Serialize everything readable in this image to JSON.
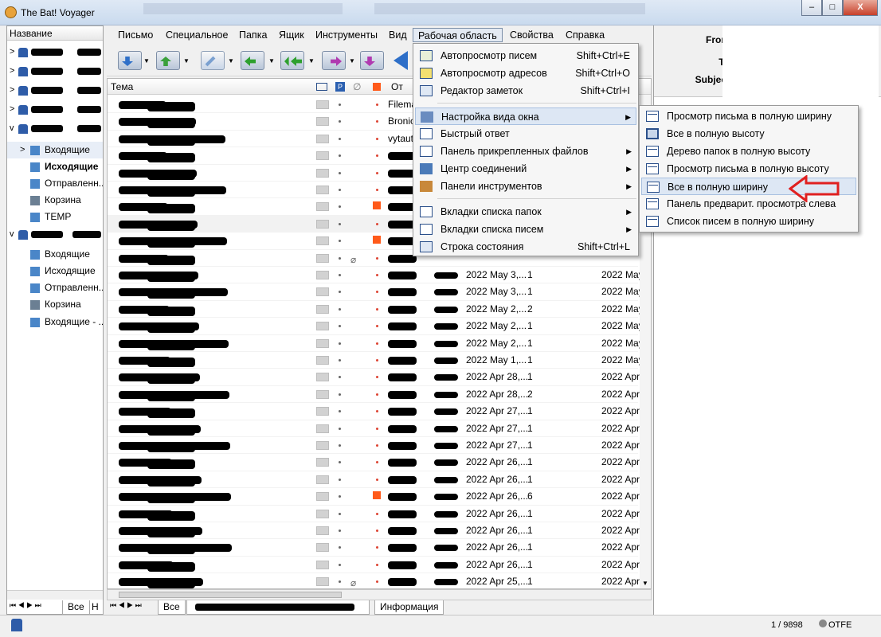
{
  "window": {
    "title": "The Bat! Voyager",
    "buttons": [
      "–",
      "□",
      "X"
    ]
  },
  "folders": {
    "header": "Название",
    "items": [
      {
        "label": "Входящие",
        "bold": false
      },
      {
        "label": "Исходящие",
        "bold": true
      },
      {
        "label": "Отправленн..",
        "bold": false
      },
      {
        "label": "Корзина",
        "bold": false
      },
      {
        "label": "TEMP",
        "bold": false
      },
      {
        "label": "Входящие",
        "bold": false
      },
      {
        "label": "Исходящие",
        "bold": false
      },
      {
        "label": "Отправленн..",
        "bold": false
      },
      {
        "label": "Корзина",
        "bold": false
      },
      {
        "label": "Входящие - ..",
        "bold": false
      }
    ],
    "tabs": [
      "Все",
      "Н"
    ]
  },
  "menubar": [
    "Письмо",
    "Специальное",
    "Папка",
    "Ящик",
    "Инструменты",
    "Вид",
    "Рабочая область",
    "Свойства",
    "Справка"
  ],
  "list": {
    "columns": {
      "subject": "Тема",
      "from": "От"
    },
    "dates": [
      "2022 May 3,...",
      "2022 May 3,...",
      "2022 May 2,...",
      "2022 May 2,...",
      "2022 May 2,...",
      "2022 May 1,...",
      "2022 Apr 28,...",
      "2022 Apr 28,...",
      "2022 Apr 27,...",
      "2022 Apr 27,...",
      "2022 Apr 27,...",
      "2022 Apr 26,...",
      "2022 Apr 26,...",
      "2022 Apr 26,...",
      "2022 Apr 26,...",
      "2022 Apr 26,...",
      "2022 Apr 26,...",
      "2022 Apr 26,...",
      "2022 Apr 25,..."
    ],
    "counts": [
      "1",
      "1",
      "2",
      "1",
      "1",
      "1",
      "1",
      "2",
      "1",
      "1",
      "1",
      "1",
      "1",
      "6",
      "1",
      "1",
      "1",
      "1",
      "1"
    ],
    "dates2": [
      "2022 May",
      "2022 May",
      "2022 May",
      "2022 May",
      "2022 May",
      "2022 May",
      "2022 Apr",
      "2022 Apr",
      "2022 Apr",
      "2022 Apr",
      "2022 Apr",
      "2022 Apr",
      "2022 Apr",
      "2022 Apr",
      "2022 Apr",
      "2022 Apr",
      "2022 Apr",
      "2022 Apr",
      "2022 Apr"
    ],
    "froms_top": [
      "Filema",
      "Bronic",
      "vytaut"
    ],
    "tabs": [
      "Все",
      "Информация"
    ]
  },
  "workspace_menu": {
    "items": [
      {
        "label": "Автопросмотр писем",
        "shortcut": "Shift+Ctrl+E"
      },
      {
        "label": "Автопросмотр адресов",
        "shortcut": "Shift+Ctrl+O"
      },
      {
        "label": "Редактор заметок",
        "shortcut": "Shift+Ctrl+I"
      },
      {
        "label": "Настройка вида окна",
        "shortcut": ""
      },
      {
        "label": "Быстрый ответ",
        "shortcut": ""
      },
      {
        "label": "Панель прикрепленных файлов",
        "shortcut": ""
      },
      {
        "label": "Центр соединений",
        "shortcut": ""
      },
      {
        "label": "Панели инструментов",
        "shortcut": ""
      },
      {
        "label": "Вкладки списка папок",
        "shortcut": ""
      },
      {
        "label": "Вкладки списка писем",
        "shortcut": ""
      },
      {
        "label": "Строка состояния",
        "shortcut": "Shift+Ctrl+L"
      }
    ]
  },
  "layout_submenu": {
    "items": [
      "Просмотр письма в полную ширину",
      "Все в полную высоту",
      "Дерево папок в полную высоту",
      "Просмотр письма в полную высоту",
      "Все в полную ширину",
      "Панель предварит. просмотра слева",
      "Список писем в полную ширину"
    ]
  },
  "preview": {
    "from_label": "From:",
    "to_label": "To:",
    "subject_label": "Subject:"
  },
  "status": {
    "count": "1 / 9898",
    "mode": "OTFE"
  },
  "colors": {
    "accent": "#2e5ca8",
    "highlight": "#dde7f4",
    "arrow": "#e02020"
  }
}
